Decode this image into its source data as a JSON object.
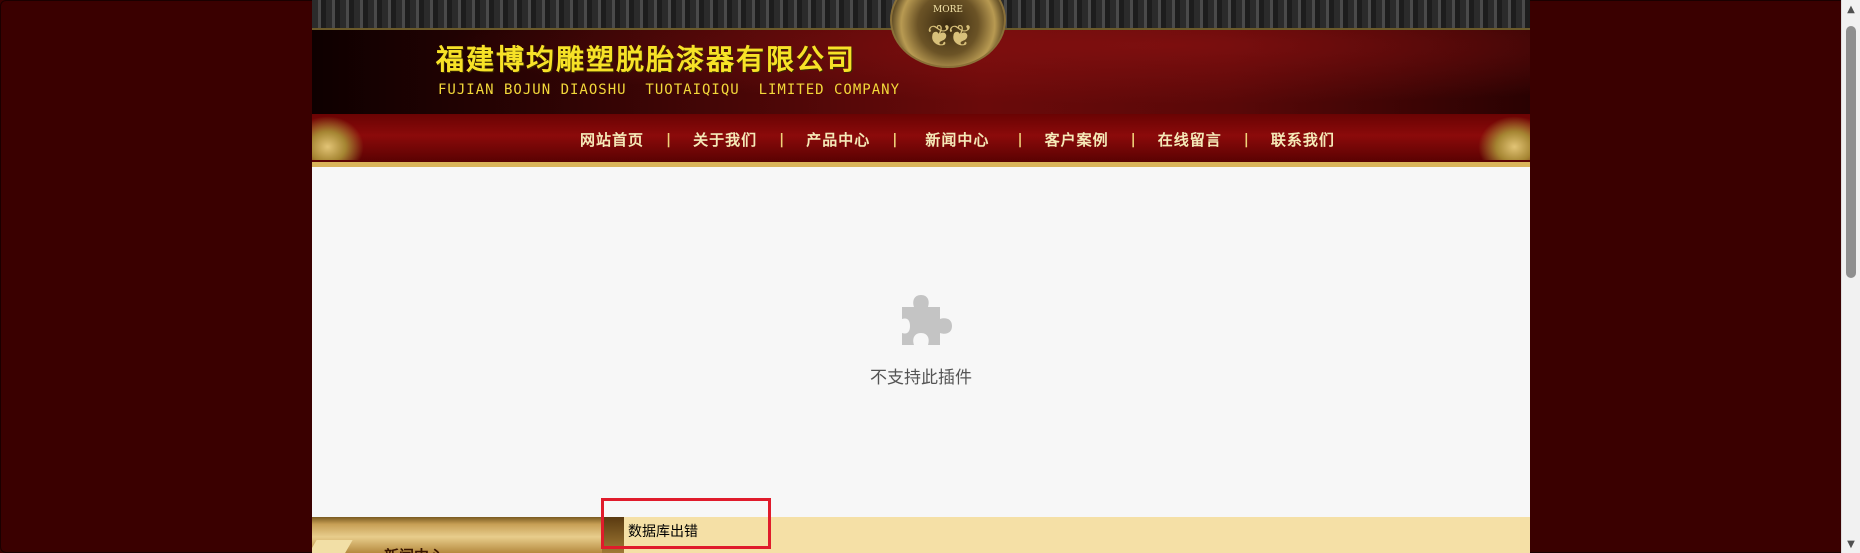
{
  "header": {
    "title_zh": "福建博均雕塑脱胎漆器有限公司",
    "title_en": "FUJIAN BOJUN DIAOSHU  TUOTAIQIQU  LIMITED COMPANY",
    "crest_text": "MORE"
  },
  "nav": {
    "items": [
      {
        "label": "网站首页"
      },
      {
        "label": "关于我们"
      },
      {
        "label": "产品中心"
      },
      {
        "label": "新闻中心"
      },
      {
        "label": "客户案例"
      },
      {
        "label": "在线留言"
      },
      {
        "label": "联系我们"
      }
    ],
    "separator": "|"
  },
  "plugin": {
    "icon": "puzzle-piece-icon",
    "message": "不支持此插件"
  },
  "bottom": {
    "left_label": "新闻中心",
    "error_text": "数据库出错"
  },
  "scrollbar": {
    "up_arrow": "▲",
    "down_arrow": "▼"
  },
  "colors": {
    "page_background": "#3a0000",
    "title_yellow": "#f7e227",
    "nav_red": "#8b0a0a",
    "highlight_red": "#e01b2b",
    "bottom_bar": "#f5e0a6"
  }
}
